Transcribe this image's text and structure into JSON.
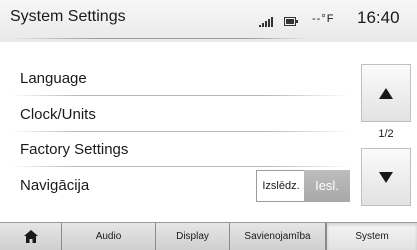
{
  "header": {
    "title": "System Settings",
    "status_icons": [
      "signal-icon",
      "battery-icon"
    ],
    "temperature": "--°F",
    "time": "16:40"
  },
  "rows": [
    {
      "label": "Language"
    },
    {
      "label": "Clock/Units"
    },
    {
      "label": "Factory Settings"
    },
    {
      "label": "Navigācija"
    }
  ],
  "toggle": {
    "off_label": "Izslēdz.",
    "on_label": "Iesl.",
    "selected": "Iesl."
  },
  "scroll": {
    "up_icon": "arrow-up-icon",
    "down_icon": "arrow-down-icon",
    "page_indicator": "1/2"
  },
  "tabs": [
    {
      "icon": "home-icon"
    },
    {
      "label": "Audio"
    },
    {
      "label": "Display"
    },
    {
      "label": "Savienojamība"
    },
    {
      "label": "System",
      "active": true
    }
  ],
  "colors": {
    "toggle_active_bg": "#b3b3b3",
    "text": "#1a1a1a"
  }
}
